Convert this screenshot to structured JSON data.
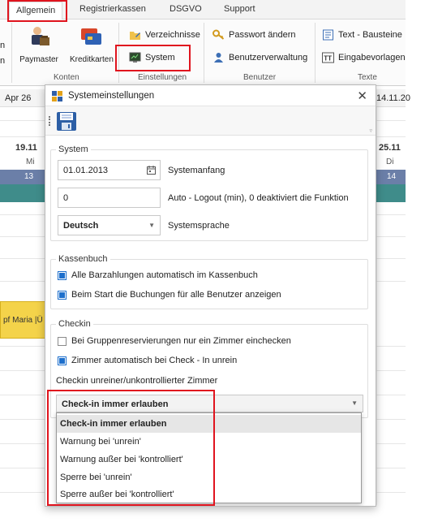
{
  "ribbon": {
    "tabs": [
      "Allgemein",
      "Registrierkassen",
      "DSGVO",
      "Support"
    ],
    "active_tab": "Allgemein",
    "left_cut_label": "n",
    "buttons": {
      "paymaster": "Paymaster",
      "kreditkarten": "Kreditkarten",
      "verzeichnisse": "Verzeichnisse",
      "system": "System",
      "passwort": "Passwort ändern",
      "benutzerverwaltung": "Benutzerverwaltung",
      "textbausteine": "Text - Bausteine",
      "eingabevorlagen": "Eingabevorlagen"
    },
    "groups": {
      "konten": "Konten",
      "einstellungen": "Einstellungen",
      "benutzer": "Benutzer",
      "texte": "Texte"
    }
  },
  "calendar": {
    "date_left": "Apr 26",
    "date_right": "14.11.20",
    "day_left": "19.11",
    "weekday_left": "Mi",
    "daynum_left": "13",
    "day_right": "25.11",
    "weekday_right": "Di",
    "daynum_right": "14",
    "booking_text": "pf Maria |Ü"
  },
  "dialog": {
    "title": "Systemeinstellungen",
    "system": {
      "group_title": "System",
      "start_date": "01.01.2013",
      "start_date_label": "Systemanfang",
      "logout_value": "0",
      "logout_label": "Auto - Logout (min), 0 deaktiviert die Funktion",
      "language_value": "Deutsch",
      "language_label": "Systemsprache"
    },
    "kassenbuch": {
      "group_title": "Kassenbuch",
      "opt1": "Alle Barzahlungen automatisch im Kassenbuch",
      "opt1_checked": true,
      "opt2": "Beim Start die Buchungen für alle Benutzer anzeigen",
      "opt2_checked": true
    },
    "checkin": {
      "group_title": "Checkin",
      "opt1": "Bei Gruppenreservierungen nur ein Zimmer einchecken",
      "opt1_checked": false,
      "opt2": "Zimmer automatisch bei Check - In unrein",
      "opt2_checked": true,
      "dropdown_label": "Checkin unreiner/unkontrollierter Zimmer",
      "dropdown_value": "Check-in immer erlauben",
      "options": [
        "Check-in immer erlauben",
        "Warnung bei 'unrein'",
        "Warnung außer bei 'kontrolliert'",
        "Sperre bei 'unrein'",
        "Sperre außer bei 'kontrolliert'"
      ]
    }
  },
  "colors": {
    "highlight": "#e0141e",
    "calendar_blue": "#6b7fa8",
    "calendar_teal": "#3f8c8a",
    "booking_yellow": "#f4d34a",
    "checkbox_blue": "#1d6fcc"
  }
}
